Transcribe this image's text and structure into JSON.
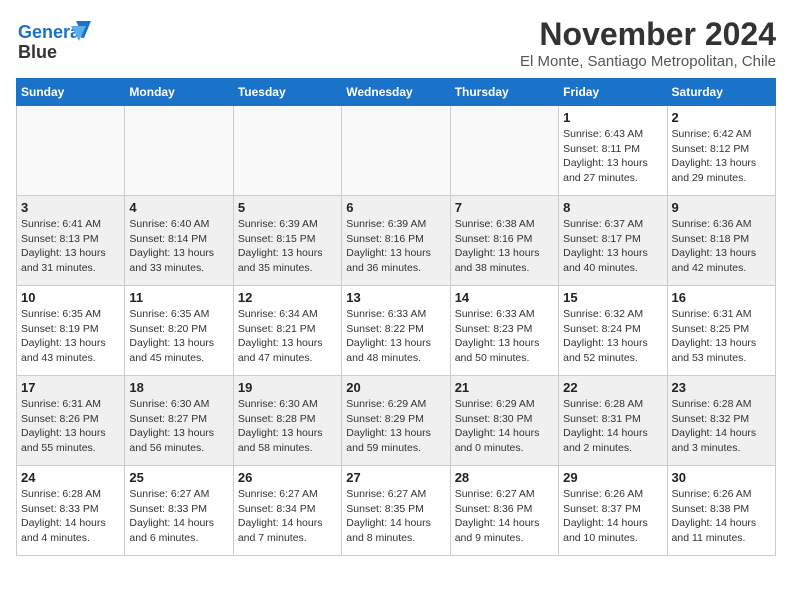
{
  "logo": {
    "line1": "General",
    "line2": "Blue"
  },
  "header": {
    "month": "November 2024",
    "location": "El Monte, Santiago Metropolitan, Chile"
  },
  "weekdays": [
    "Sunday",
    "Monday",
    "Tuesday",
    "Wednesday",
    "Thursday",
    "Friday",
    "Saturday"
  ],
  "weeks": [
    [
      {
        "day": "",
        "info": "",
        "empty": true
      },
      {
        "day": "",
        "info": "",
        "empty": true
      },
      {
        "day": "",
        "info": "",
        "empty": true
      },
      {
        "day": "",
        "info": "",
        "empty": true
      },
      {
        "day": "",
        "info": "",
        "empty": true
      },
      {
        "day": "1",
        "info": "Sunrise: 6:43 AM\nSunset: 8:11 PM\nDaylight: 13 hours\nand 27 minutes."
      },
      {
        "day": "2",
        "info": "Sunrise: 6:42 AM\nSunset: 8:12 PM\nDaylight: 13 hours\nand 29 minutes."
      }
    ],
    [
      {
        "day": "3",
        "info": "Sunrise: 6:41 AM\nSunset: 8:13 PM\nDaylight: 13 hours\nand 31 minutes.",
        "shaded": true
      },
      {
        "day": "4",
        "info": "Sunrise: 6:40 AM\nSunset: 8:14 PM\nDaylight: 13 hours\nand 33 minutes.",
        "shaded": true
      },
      {
        "day": "5",
        "info": "Sunrise: 6:39 AM\nSunset: 8:15 PM\nDaylight: 13 hours\nand 35 minutes.",
        "shaded": true
      },
      {
        "day": "6",
        "info": "Sunrise: 6:39 AM\nSunset: 8:16 PM\nDaylight: 13 hours\nand 36 minutes.",
        "shaded": true
      },
      {
        "day": "7",
        "info": "Sunrise: 6:38 AM\nSunset: 8:16 PM\nDaylight: 13 hours\nand 38 minutes.",
        "shaded": true
      },
      {
        "day": "8",
        "info": "Sunrise: 6:37 AM\nSunset: 8:17 PM\nDaylight: 13 hours\nand 40 minutes.",
        "shaded": true
      },
      {
        "day": "9",
        "info": "Sunrise: 6:36 AM\nSunset: 8:18 PM\nDaylight: 13 hours\nand 42 minutes.",
        "shaded": true
      }
    ],
    [
      {
        "day": "10",
        "info": "Sunrise: 6:35 AM\nSunset: 8:19 PM\nDaylight: 13 hours\nand 43 minutes."
      },
      {
        "day": "11",
        "info": "Sunrise: 6:35 AM\nSunset: 8:20 PM\nDaylight: 13 hours\nand 45 minutes."
      },
      {
        "day": "12",
        "info": "Sunrise: 6:34 AM\nSunset: 8:21 PM\nDaylight: 13 hours\nand 47 minutes."
      },
      {
        "day": "13",
        "info": "Sunrise: 6:33 AM\nSunset: 8:22 PM\nDaylight: 13 hours\nand 48 minutes."
      },
      {
        "day": "14",
        "info": "Sunrise: 6:33 AM\nSunset: 8:23 PM\nDaylight: 13 hours\nand 50 minutes."
      },
      {
        "day": "15",
        "info": "Sunrise: 6:32 AM\nSunset: 8:24 PM\nDaylight: 13 hours\nand 52 minutes."
      },
      {
        "day": "16",
        "info": "Sunrise: 6:31 AM\nSunset: 8:25 PM\nDaylight: 13 hours\nand 53 minutes."
      }
    ],
    [
      {
        "day": "17",
        "info": "Sunrise: 6:31 AM\nSunset: 8:26 PM\nDaylight: 13 hours\nand 55 minutes.",
        "shaded": true
      },
      {
        "day": "18",
        "info": "Sunrise: 6:30 AM\nSunset: 8:27 PM\nDaylight: 13 hours\nand 56 minutes.",
        "shaded": true
      },
      {
        "day": "19",
        "info": "Sunrise: 6:30 AM\nSunset: 8:28 PM\nDaylight: 13 hours\nand 58 minutes.",
        "shaded": true
      },
      {
        "day": "20",
        "info": "Sunrise: 6:29 AM\nSunset: 8:29 PM\nDaylight: 13 hours\nand 59 minutes.",
        "shaded": true
      },
      {
        "day": "21",
        "info": "Sunrise: 6:29 AM\nSunset: 8:30 PM\nDaylight: 14 hours\nand 0 minutes.",
        "shaded": true
      },
      {
        "day": "22",
        "info": "Sunrise: 6:28 AM\nSunset: 8:31 PM\nDaylight: 14 hours\nand 2 minutes.",
        "shaded": true
      },
      {
        "day": "23",
        "info": "Sunrise: 6:28 AM\nSunset: 8:32 PM\nDaylight: 14 hours\nand 3 minutes.",
        "shaded": true
      }
    ],
    [
      {
        "day": "24",
        "info": "Sunrise: 6:28 AM\nSunset: 8:33 PM\nDaylight: 14 hours\nand 4 minutes."
      },
      {
        "day": "25",
        "info": "Sunrise: 6:27 AM\nSunset: 8:33 PM\nDaylight: 14 hours\nand 6 minutes."
      },
      {
        "day": "26",
        "info": "Sunrise: 6:27 AM\nSunset: 8:34 PM\nDaylight: 14 hours\nand 7 minutes."
      },
      {
        "day": "27",
        "info": "Sunrise: 6:27 AM\nSunset: 8:35 PM\nDaylight: 14 hours\nand 8 minutes."
      },
      {
        "day": "28",
        "info": "Sunrise: 6:27 AM\nSunset: 8:36 PM\nDaylight: 14 hours\nand 9 minutes."
      },
      {
        "day": "29",
        "info": "Sunrise: 6:26 AM\nSunset: 8:37 PM\nDaylight: 14 hours\nand 10 minutes."
      },
      {
        "day": "30",
        "info": "Sunrise: 6:26 AM\nSunset: 8:38 PM\nDaylight: 14 hours\nand 11 minutes."
      }
    ]
  ]
}
